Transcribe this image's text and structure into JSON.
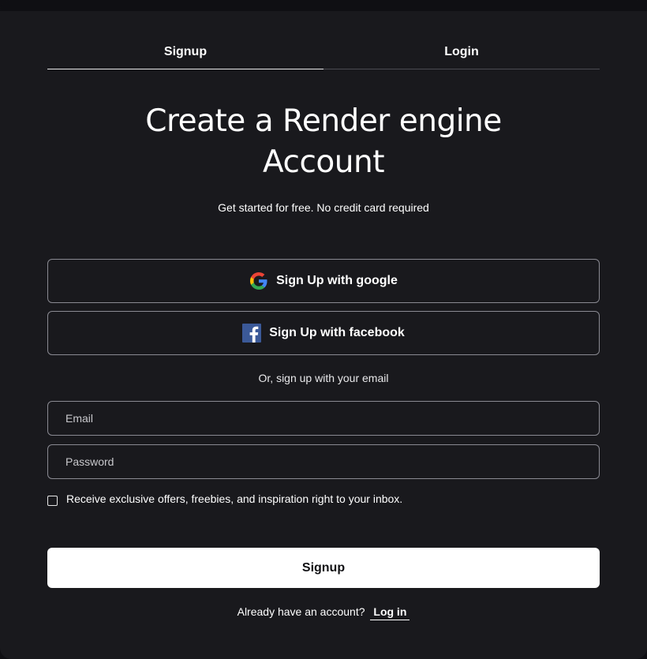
{
  "tabs": [
    {
      "label": "Signup",
      "active": true
    },
    {
      "label": "Login",
      "active": false
    }
  ],
  "heading": {
    "line1": "Create a Render engine",
    "line2": "Account"
  },
  "subtitle": "Get started for free. No credit card required",
  "social": {
    "google_label": "Sign Up with google",
    "facebook_label": "Sign Up with facebook",
    "google_icon": "google-g-icon",
    "facebook_icon": "facebook-f-icon"
  },
  "divider_text": "Or, sign up with your email",
  "form": {
    "email_placeholder": "Email",
    "email_value": "",
    "password_placeholder": "Password",
    "password_value": "",
    "newsletter_checked": false,
    "newsletter_label": "Receive exclusive offers, freebies, and inspiration right to your inbox.",
    "submit_label": "Signup"
  },
  "footer": {
    "prompt": "Already have an account?",
    "link_label": "Log in"
  },
  "colors": {
    "background": "#19191d",
    "outer": "#0f0f13",
    "text": "#ffffff",
    "border": "#8a8a92",
    "google_blue": "#4285F4",
    "google_red": "#EA4335",
    "google_yellow": "#FBBC05",
    "google_green": "#34A853",
    "facebook_blue": "#3B5998"
  }
}
